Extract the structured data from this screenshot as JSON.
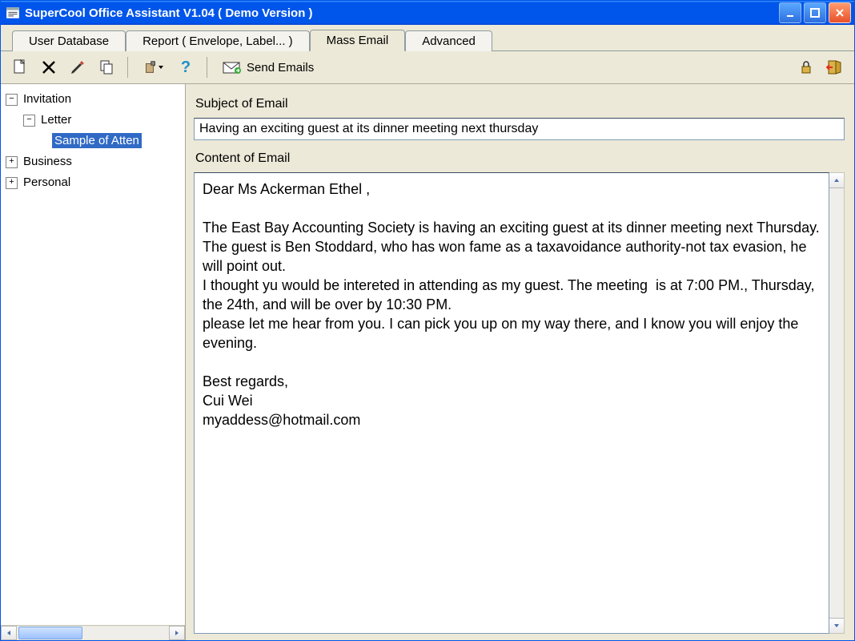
{
  "window": {
    "title": "SuperCool Office Assistant V1.04  ( Demo Version )"
  },
  "tabs": {
    "items": [
      {
        "label": "User Database"
      },
      {
        "label": "Report ( Envelope, Label... )"
      },
      {
        "label": "Mass Email"
      },
      {
        "label": "Advanced"
      }
    ],
    "active_index": 2
  },
  "toolbar": {
    "send_label": "Send Emails"
  },
  "tree": {
    "nodes": {
      "invitation": "Invitation",
      "letter": "Letter",
      "sample": "Sample of Atten",
      "business": "Business",
      "personal": "Personal"
    }
  },
  "form": {
    "subject_label": "Subject of Email",
    "subject_value": "Having an exciting guest at its dinner meeting next thursday",
    "content_label": "Content of Email",
    "content_value": "Dear Ms Ackerman Ethel ,\n\nThe East Bay Accounting Society is having an exciting guest at its dinner meeting next Thursday. The guest is Ben Stoddard, who has won fame as a taxavoidance authority-not tax evasion, he will point out.\nI thought yu would be intereted in attending as my guest. The meeting  is at 7:00 PM., Thursday, the 24th, and will be over by 10:30 PM.\nplease let me hear from you. I can pick you up on my way there, and I know you will enjoy the evening.\n\nBest regards,\nCui Wei\nmyaddess@hotmail.com"
  }
}
